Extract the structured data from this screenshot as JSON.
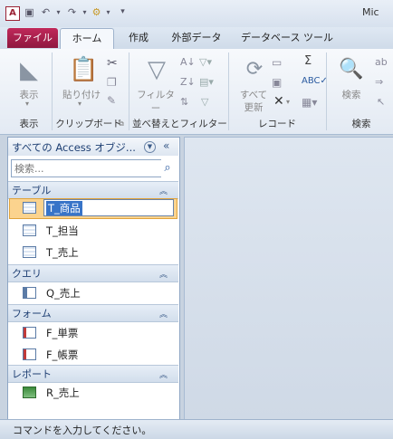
{
  "app": {
    "icon_letter": "A",
    "title_partial": "Mic"
  },
  "quick_access": [
    "save-icon",
    "undo-icon",
    "redo-icon",
    "customize-icon"
  ],
  "tabs": {
    "file": "ファイル",
    "home": "ホーム",
    "create": "作成",
    "external": "外部データ",
    "dbtools": "データベース ツール"
  },
  "ribbon": {
    "view": {
      "label": "表示",
      "group": "表示"
    },
    "clipboard": {
      "paste": "貼り付け",
      "group": "クリップボード"
    },
    "sort": {
      "filter": "フィルター",
      "group": "並べ替えとフィルター"
    },
    "records": {
      "refresh": "すべて",
      "refresh2": "更新",
      "group": "レコード",
      "sum": "Σ"
    },
    "find": {
      "label": "検索",
      "group": "検索"
    }
  },
  "nav": {
    "title": "すべての Access オブジ...",
    "search_placeholder": "検索...",
    "categories": [
      {
        "label": "テーブル",
        "items": [
          "T_商品",
          "T_担当",
          "T_売上"
        ]
      },
      {
        "label": "クエリ",
        "items": [
          "Q_売上"
        ]
      },
      {
        "label": "フォーム",
        "items": [
          "F_単票",
          "F_帳票"
        ]
      },
      {
        "label": "レポート",
        "items": [
          "R_売上"
        ]
      }
    ]
  },
  "status": {
    "text": "コマンドを入力してください。"
  },
  "colors": {
    "file_tab": "#a41e4c",
    "selection": "#fbd38e",
    "accent": "#1e3f73"
  }
}
